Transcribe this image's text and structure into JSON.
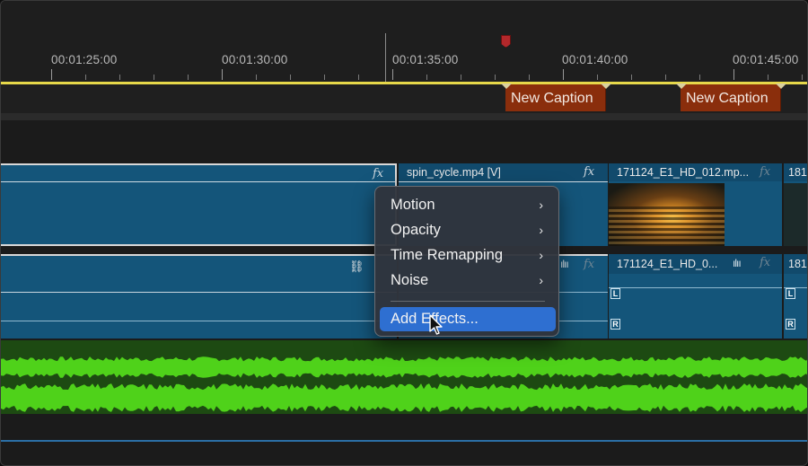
{
  "ruler": {
    "timecodes": [
      "00:01:25:00",
      "00:01:30:00",
      "00:01:35:00",
      "00:01:40:00",
      "00:01:45:00"
    ]
  },
  "captions": [
    {
      "label": "New Caption"
    },
    {
      "label": "New Caption"
    }
  ],
  "tracks": {
    "v2": {
      "clip1_name": "spin_cycle.mp4 [V]",
      "clip2_name": "171124_E1_HD_012.mp...",
      "clip3_name": "181"
    },
    "v1": {
      "clip2_name": "171124_E1_HD_0...",
      "clip3_name": "181"
    },
    "fx_label": "fx",
    "channel_left": "L",
    "channel_right": "R"
  },
  "context_menu": {
    "items": [
      {
        "label": "Motion",
        "submenu": true
      },
      {
        "label": "Opacity",
        "submenu": true
      },
      {
        "label": "Time Remapping",
        "submenu": true
      },
      {
        "label": "Noise",
        "submenu": true
      },
      {
        "label": "Add Effects...",
        "submenu": false,
        "highlighted": true
      }
    ],
    "chevron": "›"
  },
  "colors": {
    "caption": "#8a2e0c",
    "clip": "#14557a",
    "waveform": "#4fd21a",
    "menu_highlight": "#2e6fd1",
    "work_area": "#e6d84a",
    "marker": "#b3282b"
  }
}
